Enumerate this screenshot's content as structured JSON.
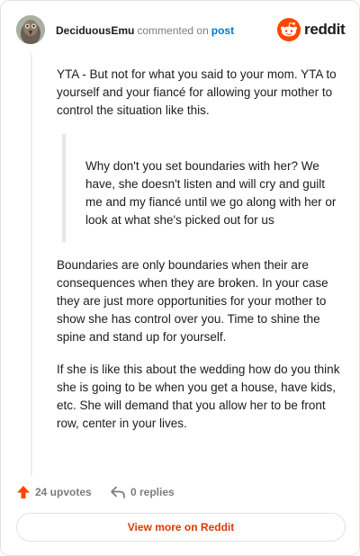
{
  "comment": {
    "author": "DeciduousEmu",
    "verb": "commented on",
    "target": "post",
    "avatar_icon": "emu-avatar-icon"
  },
  "brand": {
    "name": "reddit",
    "icon": "reddit-alien-icon",
    "color": "#ff4500"
  },
  "body": {
    "paragraph_1": "YTA - But not for what you said to your mom. YTA to yourself and your fiancé for allowing your mother to control the situation like this.",
    "quote": "Why don't you set boundaries with her? We have, she doesn't listen and will cry and guilt me and my fiancé until we go along with her or look at what she's picked out for us",
    "paragraph_2": "Boundaries are only boundaries when their are consequences when they are broken. In your case they are just more opportunities for your mother to show she has control over you. Time to shine the spine and stand up for yourself.",
    "paragraph_3": "If she is like this about the wedding how do you think she is going to be when you get a house, have kids, etc. She will demand that you allow her to be front row, center in your lives."
  },
  "actions": {
    "upvotes": "24 upvotes",
    "replies": "0 replies",
    "upvote_icon": "upvote-arrow-icon",
    "reply_icon": "reply-arrow-icon",
    "upvote_color": "#ff4500"
  },
  "footer": {
    "more_label": "View more on Reddit",
    "more_color": "#d93a00"
  }
}
